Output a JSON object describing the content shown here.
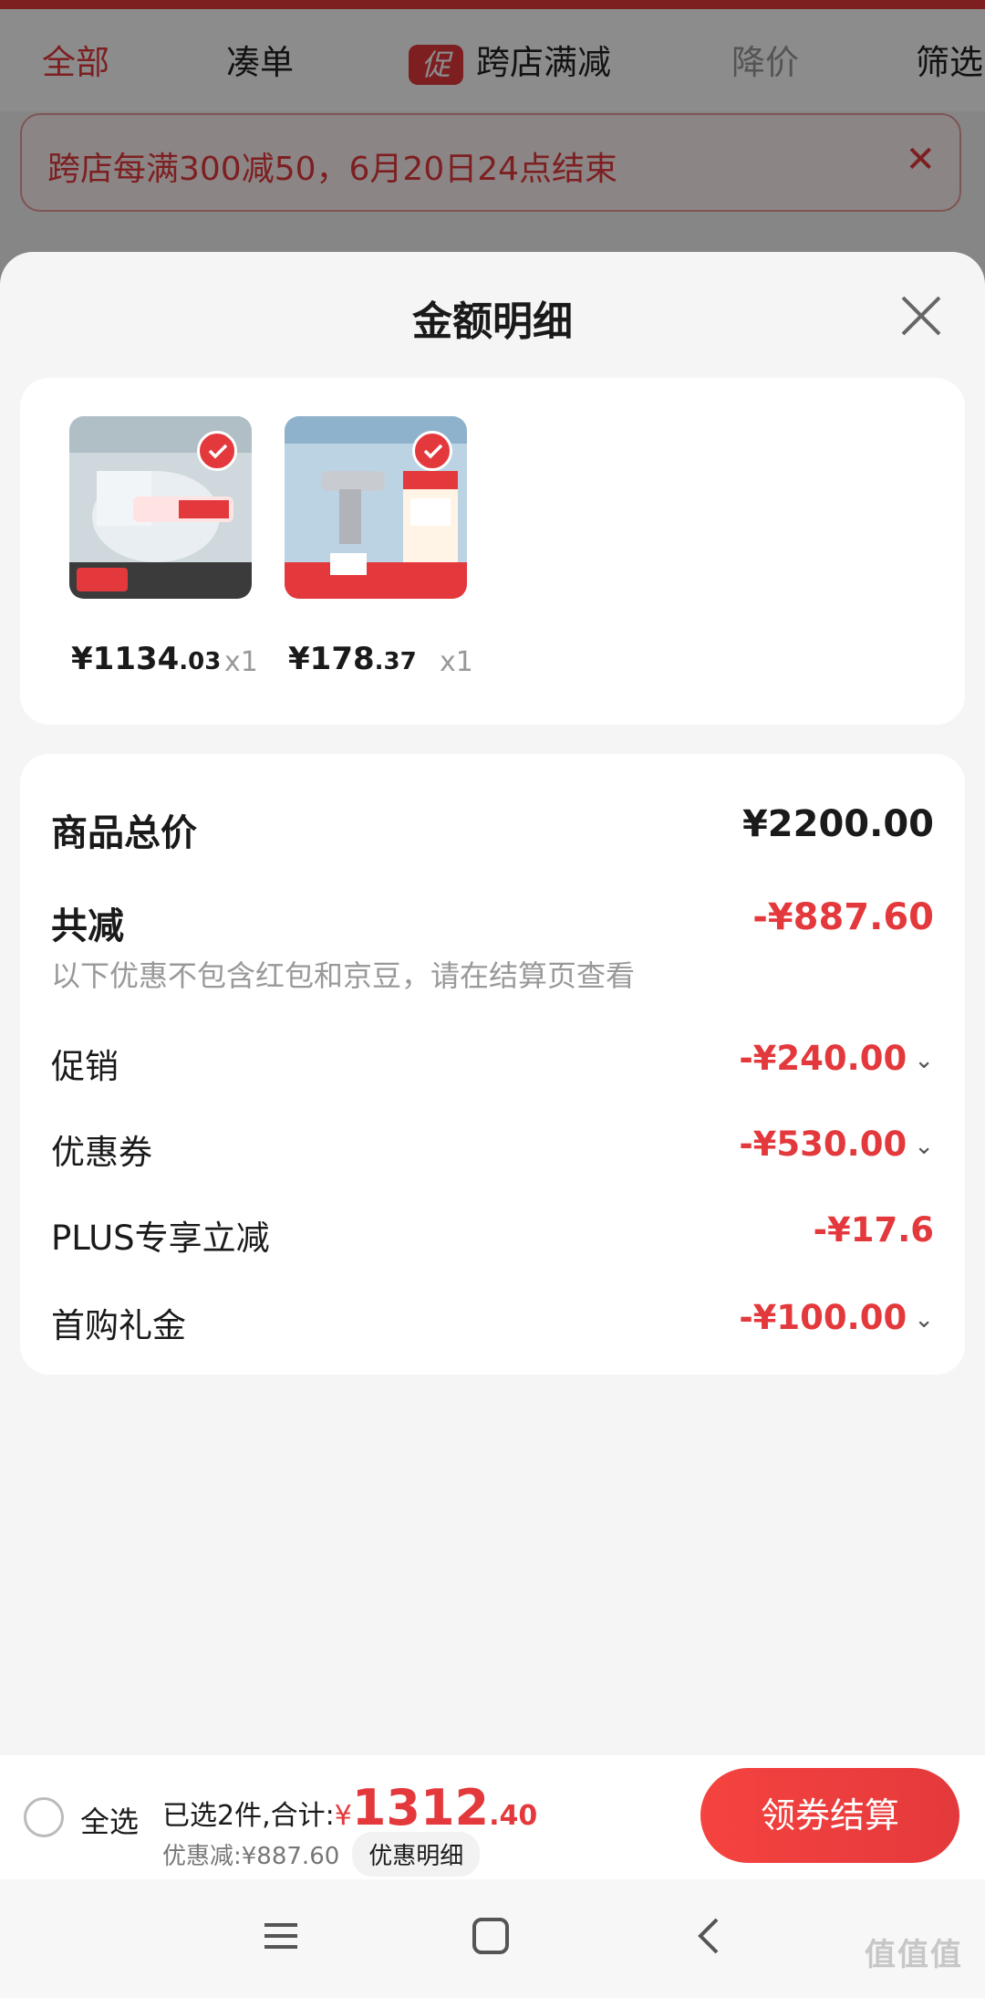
{
  "tabs": {
    "all": "全部",
    "combine": "凑单",
    "promo_icon": "促",
    "cross_store": "跨店满减",
    "price_drop": "降价",
    "filter": "筛选"
  },
  "notice": {
    "text": "跨店每满300减50，6月20日24点结束",
    "close": "✕"
  },
  "sheet": {
    "title": "金额明细"
  },
  "products": [
    {
      "price_int": "¥1134",
      "price_dec": ".03",
      "qty": "x1"
    },
    {
      "price_int": "¥178",
      "price_dec": ".37",
      "qty": "x1"
    }
  ],
  "breakdown": {
    "total_label": "商品总价",
    "total_value": "¥2200.00",
    "reduce_label": "共减",
    "reduce_value": "-¥887.60",
    "note": "以下优惠不包含红包和京豆，请在结算页查看",
    "items": [
      {
        "label": "促销",
        "value": "-¥240.00",
        "chev": "⌄"
      },
      {
        "label": "优惠券",
        "value": "-¥530.00",
        "chev": "⌄"
      },
      {
        "label": "PLUS专享立减",
        "value": "-¥17.6"
      },
      {
        "label": "首购礼金",
        "value": "-¥100.00",
        "chev": "⌄"
      }
    ]
  },
  "bottom": {
    "select_all": "全选",
    "summary_prefix": "已选2件,合计:",
    "yen": "¥",
    "total_int": "1312",
    "total_dec": ".40",
    "discount": "优惠减:¥887.60",
    "detail_button": "优惠明细",
    "checkout": "领券结算"
  },
  "colors": {
    "accent": "#e4393c"
  },
  "icons": {
    "menu": "menu-icon",
    "home": "home-icon",
    "back": "back-icon"
  },
  "watermark": "值值值"
}
